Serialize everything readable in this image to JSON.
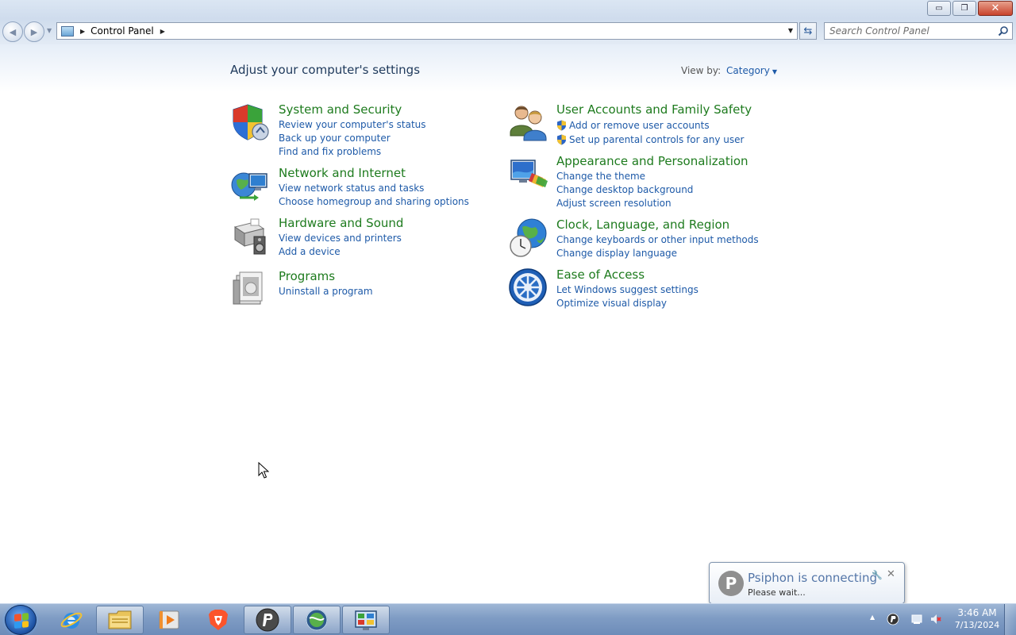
{
  "window": {
    "minimize_label": "▭",
    "maximize_label": "❐",
    "close_label": "✕"
  },
  "address": {
    "crumb": "Control Panel",
    "search_placeholder": "Search Control Panel"
  },
  "content": {
    "title": "Adjust your computer's settings",
    "view_by_label": "View by:",
    "view_by_value": "Category"
  },
  "categories": [
    {
      "title": "System and Security",
      "icon": "shield-security-icon",
      "links": [
        "Review your computer's status",
        "Back up your computer",
        "Find and fix problems"
      ]
    },
    {
      "title": "Network and Internet",
      "icon": "network-globe-icon",
      "links": [
        "View network status and tasks",
        "Choose homegroup and sharing options"
      ]
    },
    {
      "title": "Hardware and Sound",
      "icon": "printer-speaker-icon",
      "links": [
        "View devices and printers",
        "Add a device"
      ]
    },
    {
      "title": "Programs",
      "icon": "programs-box-icon",
      "links": [
        "Uninstall a program"
      ]
    },
    {
      "title": "User Accounts and Family Safety",
      "icon": "users-icon",
      "links": [
        "Add or remove user accounts",
        "Set up parental controls for any user"
      ]
    },
    {
      "title": "Appearance and Personalization",
      "icon": "monitor-palette-icon",
      "links": [
        "Change the theme",
        "Change desktop background",
        "Adjust screen resolution"
      ]
    },
    {
      "title": "Clock, Language, and Region",
      "icon": "clock-globe-icon",
      "links": [
        "Change keyboards or other input methods",
        "Change display language"
      ]
    },
    {
      "title": "Ease of Access",
      "icon": "ease-of-access-icon",
      "links": [
        "Let Windows suggest settings",
        "Optimize visual display"
      ]
    }
  ],
  "notification": {
    "title": "Psiphon is connecting",
    "message": "Please wait...",
    "icon_letter": "P"
  },
  "taskbar": {
    "time": "3:46 AM",
    "date": "7/13/2024",
    "apps": [
      "internet-explorer-icon",
      "file-explorer-icon",
      "media-player-icon",
      "brave-icon",
      "psiphon-icon",
      "network-globe-app-icon",
      "control-panel-app-icon"
    ]
  },
  "colors": {
    "category_title": "#1e7b1e",
    "link": "#1e5aa8",
    "heading": "#1e395b"
  }
}
